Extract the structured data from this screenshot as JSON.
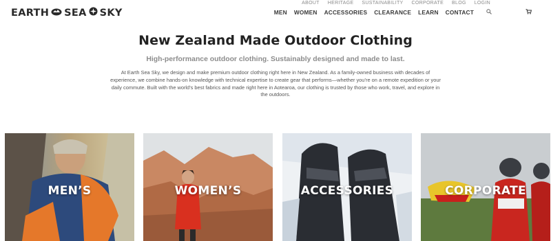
{
  "brand": {
    "logo_parts": [
      "EARTH",
      "SEA",
      "SKY"
    ]
  },
  "top_nav": [
    "ABOUT",
    "HERITAGE",
    "SUSTAINABILITY",
    "CORPORATE",
    "BLOG",
    "LOGIN"
  ],
  "main_nav": [
    "MEN",
    "WOMEN",
    "ACCESSORIES",
    "CLEARANCE",
    "LEARN",
    "CONTACT"
  ],
  "icons": {
    "search": "search-icon",
    "cart": "cart-icon"
  },
  "hero": {
    "title": "New Zealand Made Outdoor Clothing",
    "subtitle": "High-performance outdoor clothing. Sustainably designed and made to last.",
    "body": "At Earth Sea Sky, we design and make premium outdoor clothing right here in New Zealand. As a family-owned business with decades of experience, we combine hands-on knowledge with technical expertise to create gear that performs—whether you’re on a remote expedition or your daily commute. Built with the world’s best fabrics and made right here in Aotearoa, our clothing is trusted by those who work, travel, and explore in the outdoors."
  },
  "categories": [
    {
      "label": "MEN’S"
    },
    {
      "label": "WOMEN’S"
    },
    {
      "label": "ACCESSORIES"
    },
    {
      "label": "CORPORATE"
    }
  ],
  "colors": {
    "text_dark": "#2a2a2a",
    "subtitle_grey": "#8c8c8c",
    "nav_light": "#8a8a8a"
  }
}
